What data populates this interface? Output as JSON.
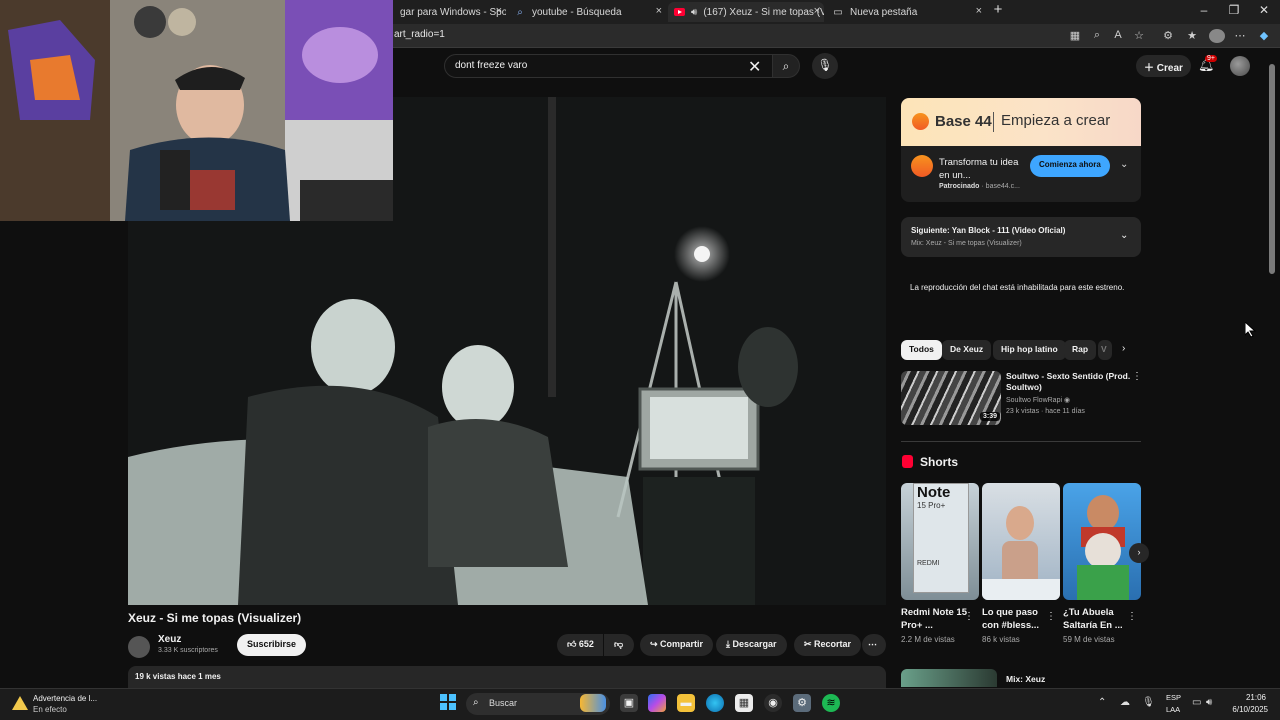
{
  "browser": {
    "tabs": [
      {
        "title": "gar para Windows - Spotif",
        "icon": "spotify-icon"
      },
      {
        "title": "youtube - Búsqueda",
        "icon": "search-icon"
      },
      {
        "title": "(167) Xeuz - Si me topas (Vi",
        "icon": "youtube-icon",
        "active": true
      },
      {
        "title": "Nueva pestaña",
        "icon": "newtab-icon"
      }
    ],
    "url": "art_radio=1"
  },
  "youtube": {
    "search_value": "dont freeze varo",
    "create_label": "Crear",
    "notif_count": "9+",
    "video": {
      "title": "Xeuz - Si me topas (Visualizer)",
      "channel": "Xeuz",
      "subs": "3.33 K suscriptores",
      "subscribe_label": "Suscribirse",
      "likes": "652",
      "share_label": "Compartir",
      "download_label": "Descargar",
      "clip_label": "Recortar",
      "meta": "19 k vistas  hace 1 mes"
    },
    "ad": {
      "brand": "Base 44",
      "tagline": "Empieza a crear",
      "text": "Transforma tu idea en un...",
      "sponsored": "Patrocinado",
      "domain": "· base44.c...",
      "cta": "Comienza ahora"
    },
    "next": {
      "title": "Siguiente: Yan Block - 111 (Video Oficial)",
      "sub": "Mix: Xeuz - Si me topas (Visualizer)"
    },
    "chat_disabled": "La reproducción del chat está inhabilitada para este estreno.",
    "chips": [
      "Todos",
      "De Xeuz",
      "Hip hop latino",
      "Rap",
      "V"
    ],
    "recommended": {
      "title": "Soultwo - Sexto Sentido (Prod. Soultwo)",
      "channel": "Soultwo FlowRapi",
      "meta": "23 k vistas · hace 11 días",
      "duration": "3:39"
    },
    "shorts_title": "Shorts",
    "shorts": [
      {
        "title": "Redmi Note 15 Pro+ ...",
        "views": "2.2 M de vistas",
        "thumb_text": "Note",
        "thumb_sub": "15 Pro+",
        "thumb_brand": "REDMI"
      },
      {
        "title": "Lo que paso con #bless...",
        "views": "86 k vistas"
      },
      {
        "title": "¿Tu Abuela Saltaría En ...",
        "views": "59 M de vistas"
      }
    ],
    "mix_row": "Mix: Xeuz"
  },
  "taskbar": {
    "warning_title": "Advertencia de l...",
    "warning_sub": "En efecto",
    "search_label": "Buscar",
    "lang1": "ESP",
    "lang2": "LAA",
    "time": "21:06",
    "date": "6/10/2025"
  }
}
